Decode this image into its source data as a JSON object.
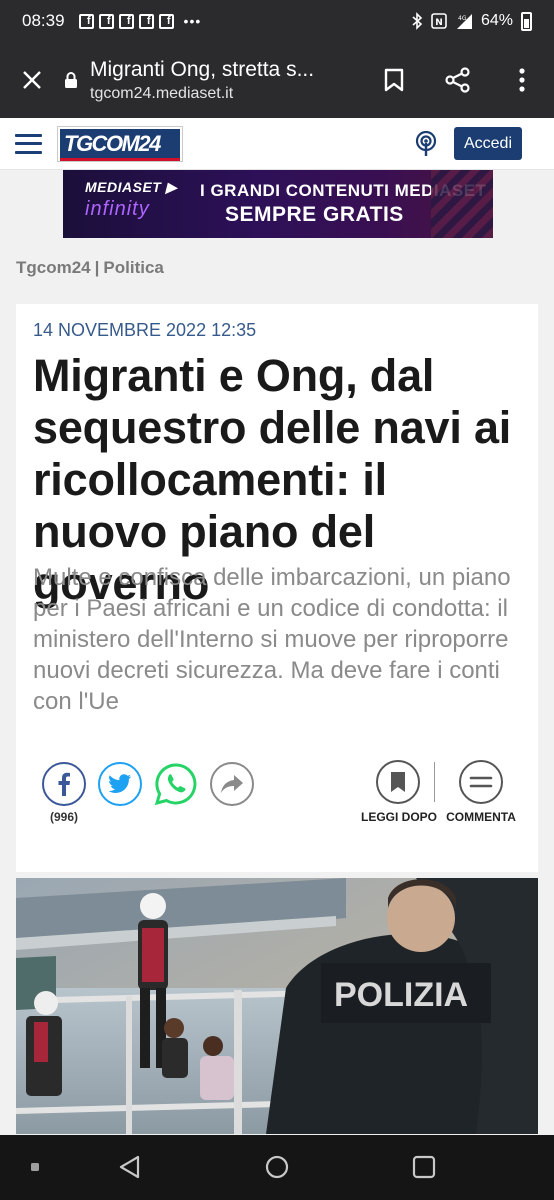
{
  "status_bar": {
    "time": "08:39",
    "notification_icons": [
      "facebook-icon",
      "facebook-icon",
      "facebook-icon",
      "facebook-icon",
      "facebook-icon"
    ],
    "more": "•••",
    "battery": "64%"
  },
  "browser": {
    "page_title": "Migranti Ong, stretta s...",
    "domain": "tgcom24.mediaset.it"
  },
  "site": {
    "logo": "TGCOM24",
    "login_label": "Accedi"
  },
  "ad": {
    "brand": "MEDIASET ▶",
    "brand_sub": "infinity",
    "line1": "I GRANDI CONTENUTI MEDIASET",
    "line2": "SEMPRE GRATIS"
  },
  "breadcrumb": {
    "items": [
      "Tgcom24",
      "Politica"
    ],
    "separator": "|"
  },
  "article": {
    "date": "14 NOVEMBRE 2022 12:35",
    "title": "Migranti e Ong, dal sequestro delle navi ai ricollocamenti: il nuovo piano del governo",
    "subtitle": "Multe e confisca delle imbarcazioni, un piano per i Paesi africani e un codice di condotta: il ministero dell'Interno si muove per riproporre nuovi decreti sicurezza. Ma deve fare i conti con l'Ue",
    "share_count": "(996)",
    "read_later_label": "LEGGI DOPO",
    "comment_label": "COMMENTA",
    "photo_text": "POLIZIA"
  }
}
